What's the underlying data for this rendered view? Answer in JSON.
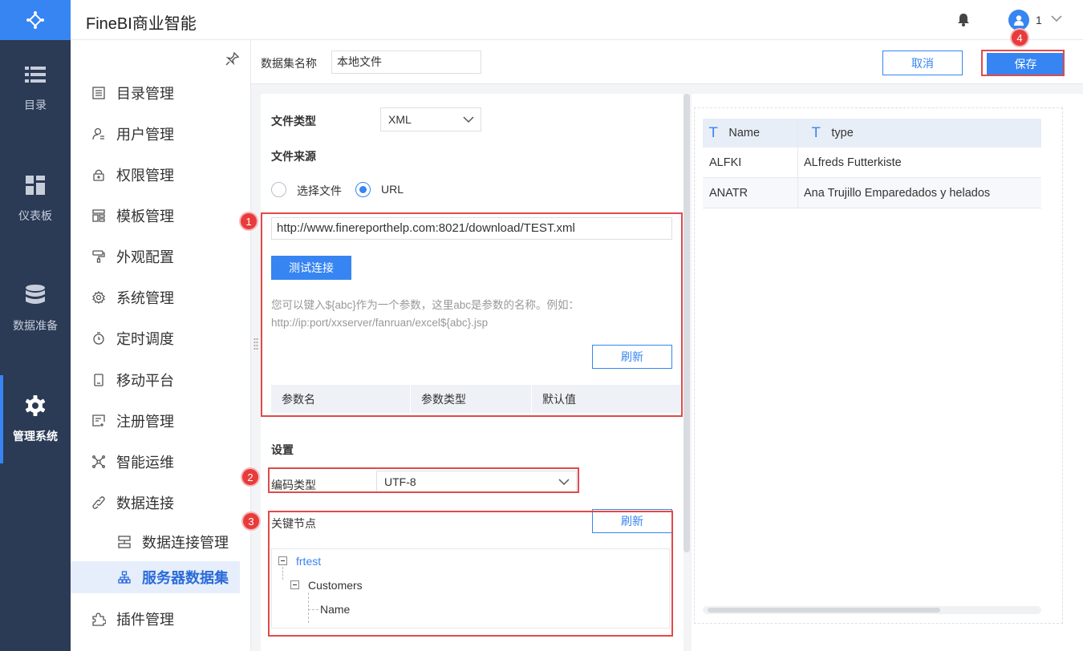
{
  "app": {
    "title": "FineBI商业智能",
    "username": "1"
  },
  "leftnav": [
    {
      "label": "目录",
      "icon": "list-icon"
    },
    {
      "label": "仪表板",
      "icon": "dashboard-icon"
    },
    {
      "label": "数据准备",
      "icon": "database-icon"
    },
    {
      "label": "管理系统",
      "icon": "gear-icon",
      "active": true
    }
  ],
  "sidemenu": {
    "items": [
      {
        "label": "目录管理",
        "icon": "catalog-icon"
      },
      {
        "label": "用户管理",
        "icon": "user-icon"
      },
      {
        "label": "权限管理",
        "icon": "lock-icon"
      },
      {
        "label": "模板管理",
        "icon": "template-icon"
      },
      {
        "label": "外观配置",
        "icon": "paint-roller-icon"
      },
      {
        "label": "系统管理",
        "icon": "settings-icon"
      },
      {
        "label": "定时调度",
        "icon": "timer-icon"
      },
      {
        "label": "移动平台",
        "icon": "mobile-icon"
      },
      {
        "label": "注册管理",
        "icon": "register-icon"
      },
      {
        "label": "智能运维",
        "icon": "ops-icon"
      },
      {
        "label": "数据连接",
        "icon": "link-icon"
      }
    ],
    "sub_items": [
      {
        "label": "数据连接管理",
        "icon": "server-icon"
      },
      {
        "label": "服务器数据集",
        "icon": "dataset-icon",
        "selected": true
      }
    ],
    "last_item": {
      "label": "插件管理",
      "icon": "plugin-icon"
    }
  },
  "dataset": {
    "name_label": "数据集名称",
    "name_value": "本地文件",
    "cancel_label": "取消",
    "save_label": "保存"
  },
  "form": {
    "file_type_label": "文件类型",
    "file_type_value": "XML",
    "file_source_label": "文件来源",
    "source_option_file": "选择文件",
    "source_option_url": "URL",
    "url_value": "http://www.finereporthelp.com:8021/download/TEST.xml",
    "test_button": "测试连接",
    "hint_line1": "您可以键入${abc}作为一个参数，这里abc是参数的名称。例如：",
    "hint_line2": "http://ip:port/xxserver/fanruan/excel${abc}.jsp",
    "refresh_button": "刷新",
    "param_columns": [
      "参数名",
      "参数类型",
      "默认值"
    ],
    "settings_label": "设置",
    "encoding_label": "编码类型",
    "encoding_value": "UTF-8",
    "key_node_label": "关键节点",
    "key_node_refresh": "刷新",
    "tree": {
      "root": "frtest",
      "child": "Customers",
      "leaf": "Name"
    }
  },
  "annotations": [
    "1",
    "2",
    "3",
    "4"
  ],
  "preview": {
    "columns": [
      "Name",
      "type"
    ],
    "rows": [
      [
        "ALFKI",
        "ALfreds Futterkiste"
      ],
      [
        "ANATR",
        "Ana Trujillo Emparedados y helados"
      ]
    ]
  },
  "colors": {
    "accent": "#3685f2",
    "nav_bg": "#2b3a55",
    "annotation": "#e04a4a"
  }
}
